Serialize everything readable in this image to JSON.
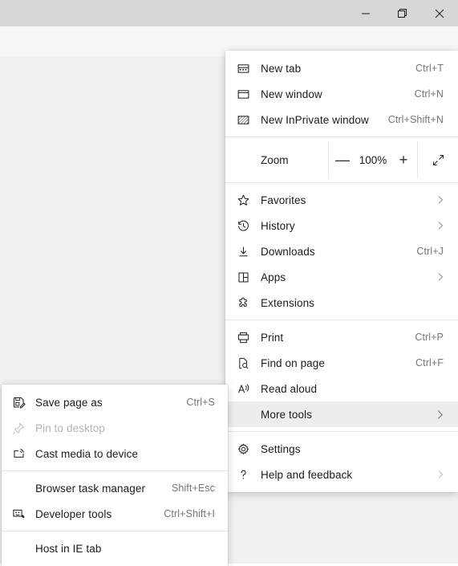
{
  "window": {
    "controls": [
      {
        "name": "minimize",
        "glyph": "—"
      },
      {
        "name": "maximize",
        "glyph": "❐"
      },
      {
        "name": "close",
        "glyph": "✕"
      }
    ]
  },
  "toolbar": {
    "address_value": "",
    "address_placeholder": "",
    "favorite_icon": "star-icon",
    "profile_icon": "person-icon",
    "settings_icon": "ellipsis-icon",
    "settings_label": "···"
  },
  "main_menu": {
    "items": [
      {
        "icon": "new-tab-icon",
        "label": "New tab",
        "accel": "Ctrl+T",
        "chevron": false,
        "type": "item"
      },
      {
        "icon": "new-window-icon",
        "label": "New window",
        "accel": "Ctrl+N",
        "chevron": false,
        "type": "item"
      },
      {
        "icon": "inprivate-window-icon",
        "label": "New InPrivate window",
        "accel": "Ctrl+Shift+N",
        "chevron": false,
        "type": "item"
      },
      {
        "type": "separator"
      },
      {
        "type": "zoom",
        "label": "Zoom",
        "value": "100%",
        "minus": "—",
        "plus": "+",
        "fullscreen_icon": "fullscreen-icon"
      },
      {
        "type": "separator"
      },
      {
        "icon": "star-icon",
        "label": "Favorites",
        "accel": "",
        "chevron": true,
        "type": "item"
      },
      {
        "icon": "history-icon",
        "label": "History",
        "accel": "",
        "chevron": true,
        "type": "item"
      },
      {
        "icon": "download-icon",
        "label": "Downloads",
        "accel": "Ctrl+J",
        "chevron": false,
        "type": "item"
      },
      {
        "icon": "apps-icon",
        "label": "Apps",
        "accel": "",
        "chevron": true,
        "type": "item"
      },
      {
        "icon": "extensions-icon",
        "label": "Extensions",
        "accel": "",
        "chevron": false,
        "type": "item"
      },
      {
        "type": "separator"
      },
      {
        "icon": "print-icon",
        "label": "Print",
        "accel": "Ctrl+P",
        "chevron": false,
        "type": "item"
      },
      {
        "icon": "find-on-page-icon",
        "label": "Find on page",
        "accel": "Ctrl+F",
        "chevron": false,
        "type": "item"
      },
      {
        "icon": "read-aloud-icon",
        "label": "Read aloud",
        "accel": "",
        "chevron": false,
        "type": "item"
      },
      {
        "icon": "",
        "label": "More tools",
        "accel": "",
        "chevron": true,
        "type": "item",
        "highlighted": true
      },
      {
        "type": "separator"
      },
      {
        "icon": "gear-icon",
        "label": "Settings",
        "accel": "",
        "chevron": false,
        "type": "item"
      },
      {
        "icon": "help-icon",
        "label": "Help and feedback",
        "accel": "",
        "chevron": true,
        "type": "item"
      }
    ]
  },
  "sub_menu": {
    "items": [
      {
        "icon": "save-page-icon",
        "label": "Save page as",
        "accel": "Ctrl+S",
        "disabled": false,
        "type": "item"
      },
      {
        "icon": "pin-icon",
        "label": "Pin to desktop",
        "accel": "",
        "disabled": true,
        "type": "item"
      },
      {
        "icon": "cast-icon",
        "label": "Cast media to device",
        "accel": "",
        "disabled": false,
        "type": "item"
      },
      {
        "type": "separator"
      },
      {
        "icon": "",
        "label": "Browser task manager",
        "accel": "Shift+Esc",
        "disabled": false,
        "type": "item"
      },
      {
        "icon": "devtools-icon",
        "label": "Developer tools",
        "accel": "Ctrl+Shift+I",
        "disabled": false,
        "type": "item"
      },
      {
        "type": "separator"
      },
      {
        "icon": "",
        "label": "Host in IE tab",
        "accel": "",
        "disabled": false,
        "type": "item"
      }
    ]
  },
  "colors": {
    "titlebar": "#d9d8d4",
    "toolbar": "#f7f7f7",
    "menu_bg": "#ffffff",
    "highlight": "#ededed",
    "separator": "#e6e6e6",
    "text": "#1b1b1b",
    "accel_text": "#767676",
    "disabled_text": "#b4b4b4",
    "page_bg": "#f1f1f1"
  }
}
